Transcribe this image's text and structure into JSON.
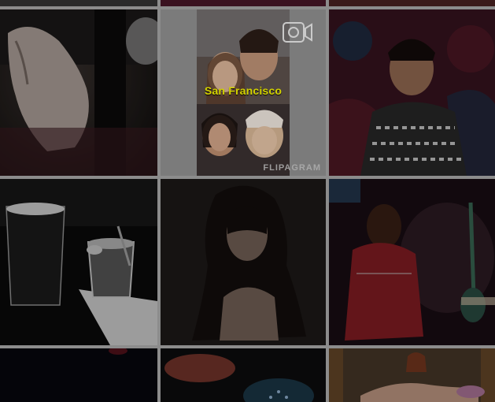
{
  "feed": {
    "tiles": [
      {
        "id": "r0c0",
        "media": "photo"
      },
      {
        "id": "r0c1",
        "media": "photo"
      },
      {
        "id": "r0c2",
        "media": "photo"
      },
      {
        "id": "r1c0",
        "media": "photo"
      },
      {
        "id": "r1c1",
        "media": "video",
        "caption": "San Francisco",
        "watermark": "FLIPAGRAM"
      },
      {
        "id": "r1c2",
        "media": "photo"
      },
      {
        "id": "r2c0",
        "media": "photo"
      },
      {
        "id": "r2c1",
        "media": "photo"
      },
      {
        "id": "r2c2",
        "media": "photo"
      },
      {
        "id": "r3c0",
        "media": "photo"
      },
      {
        "id": "r3c1",
        "media": "photo"
      },
      {
        "id": "r3c2",
        "media": "photo"
      }
    ]
  },
  "colors": {
    "gutter": "#8c8c8c",
    "caption": "#f1f000"
  },
  "icons": {
    "video_badge": "video-camera-icon"
  }
}
